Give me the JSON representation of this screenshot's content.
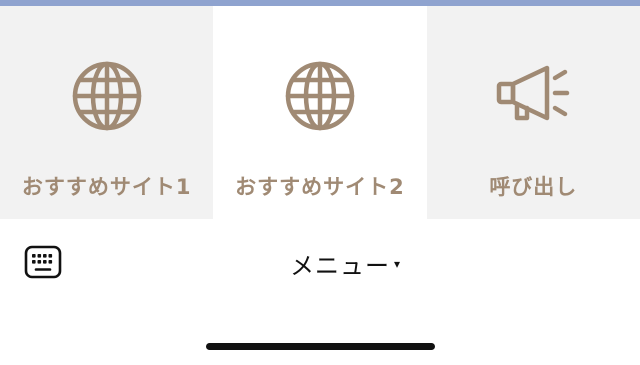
{
  "colors": {
    "top_bar": "#8fa3cf",
    "tile_gray": "#f2f2f2",
    "tile_white": "#ffffff",
    "icon_and_label": "#a08a74",
    "menu_text": "#111111"
  },
  "tiles": [
    {
      "label": "おすすめサイト1",
      "icon": "globe-icon"
    },
    {
      "label": "おすすめサイト2",
      "icon": "globe-icon"
    },
    {
      "label": "呼び出し",
      "icon": "megaphone-icon"
    }
  ],
  "menu": {
    "label": "メニュー",
    "caret": "▾",
    "keyboard_icon": "keyboard-icon"
  }
}
